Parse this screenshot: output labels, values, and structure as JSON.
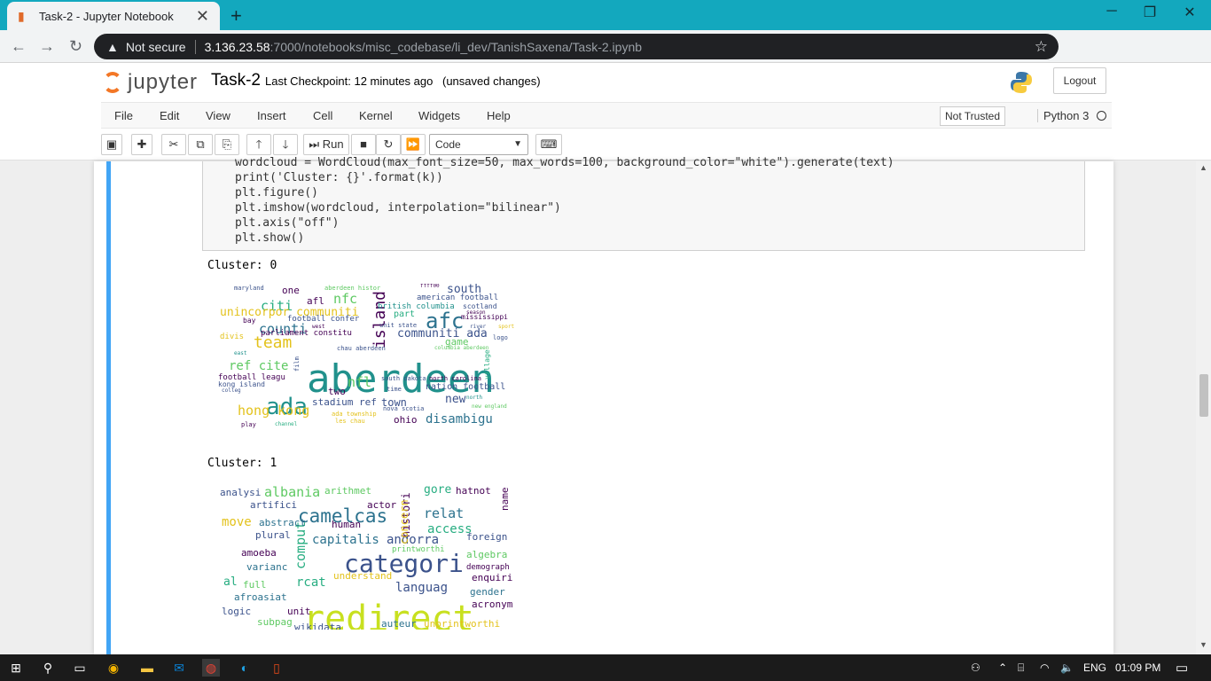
{
  "browser": {
    "tab_title": "Task-2 - Jupyter Notebook",
    "tab_close": "✕",
    "new_tab": "+",
    "security": "Not secure",
    "url_host": "3.136.23.58",
    "url_path": ":7000/notebooks/misc_codebase/li_dev/TanishSaxena/Task-2.ipynb"
  },
  "jupyter": {
    "logo_text": "jupyter",
    "notebook_name": "Task-2",
    "checkpoint_label": "Last Checkpoint:",
    "checkpoint_time": "12 minutes ago",
    "unsaved": "(unsaved changes)",
    "logout": "Logout",
    "menu": [
      "File",
      "Edit",
      "View",
      "Insert",
      "Cell",
      "Kernel",
      "Widgets",
      "Help"
    ],
    "trust": "Not Trusted",
    "kernel": "Python 3",
    "run_label": "Run",
    "cell_type": "Code"
  },
  "code_lines": [
    "wordcloud = WordCloud(max_font_size=50, max_words=100, background_color=\"white\").generate(text)",
    "print('Cluster: {}'.format(k))",
    "plt.figure()",
    "plt.imshow(wordcloud, interpolation=\"bilinear\")",
    "plt.axis(\"off\")",
    "plt.show()"
  ],
  "outputs": [
    {
      "label": "Cluster: 0",
      "words": [
        {
          "t": "aberdeen",
          "c": "#21918c",
          "s": 44
        },
        {
          "t": "ada",
          "c": "#21918c",
          "s": 26
        },
        {
          "t": "afc",
          "c": "#2c728e",
          "s": 24
        },
        {
          "t": "island",
          "c": "#440154",
          "s": 18
        },
        {
          "t": "team",
          "c": "#e3c21c",
          "s": 18
        },
        {
          "t": "counti",
          "c": "#2c728e",
          "s": 15
        },
        {
          "t": "citi",
          "c": "#27ad81",
          "s": 15
        },
        {
          "t": "nfc",
          "c": "#5ec962",
          "s": 15
        },
        {
          "t": "nfl",
          "c": "#5ec962",
          "s": 15
        },
        {
          "t": "hong kong",
          "c": "#e3c21c",
          "s": 15
        },
        {
          "t": "disambigu",
          "c": "#2c728e",
          "s": 14
        },
        {
          "t": "ref cite",
          "c": "#5ec962",
          "s": 14
        },
        {
          "t": "unincorpor communiti",
          "c": "#e3c21c",
          "s": 13
        },
        {
          "t": "communiti ada",
          "c": "#3b528b",
          "s": 13
        },
        {
          "t": "south",
          "c": "#3b528b",
          "s": 13
        },
        {
          "t": "new",
          "c": "#3b528b",
          "s": 13
        },
        {
          "t": "one",
          "c": "#440154",
          "s": 11
        },
        {
          "t": "afl",
          "c": "#440154",
          "s": 11
        },
        {
          "t": "two",
          "c": "#440154",
          "s": 11
        },
        {
          "t": "town",
          "c": "#3b528b",
          "s": 12
        },
        {
          "t": "game",
          "c": "#5ec962",
          "s": 11
        },
        {
          "t": "part",
          "c": "#27ad81",
          "s": 10
        },
        {
          "t": "ohio",
          "c": "#440154",
          "s": 11
        },
        {
          "t": "stadium ref",
          "c": "#3b528b",
          "s": 11
        },
        {
          "t": "nation football",
          "c": "#3b528b",
          "s": 10
        },
        {
          "t": "american football",
          "c": "#3b528b",
          "s": 9
        },
        {
          "t": "british columbia",
          "c": "#21918c",
          "s": 9
        },
        {
          "t": "scotland",
          "c": "#3b528b",
          "s": 8
        },
        {
          "t": "parliament constitu",
          "c": "#440154",
          "s": 9
        },
        {
          "t": "football confer",
          "c": "#3b528b",
          "s": 9
        },
        {
          "t": "football leagu",
          "c": "#440154",
          "s": 9
        },
        {
          "t": "kong island",
          "c": "#3b528b",
          "s": 8
        },
        {
          "t": "divis",
          "c": "#e3c21c",
          "s": 9
        },
        {
          "t": "mississippi",
          "c": "#440154",
          "s": 8
        },
        {
          "t": "south dakota",
          "c": "#3b528b",
          "s": 7
        },
        {
          "t": "north carolina",
          "c": "#440154",
          "s": 7
        },
        {
          "t": "village",
          "c": "#27ad81",
          "s": 8
        },
        {
          "t": "maryland",
          "c": "#3b528b",
          "s": 7
        },
        {
          "t": "aberdeen histor",
          "c": "#5ec962",
          "s": 7
        },
        {
          "t": "ffff00",
          "c": "#440154",
          "s": 6
        },
        {
          "t": "bay",
          "c": "#440154",
          "s": 8
        },
        {
          "t": "unit state",
          "c": "#3b528b",
          "s": 7
        },
        {
          "t": "chau aberdeen",
          "c": "#3b528b",
          "s": 7
        },
        {
          "t": "columbia aberdeen",
          "c": "#5ec962",
          "s": 6
        },
        {
          "t": "nova scotia",
          "c": "#3b528b",
          "s": 7
        },
        {
          "t": "ada township",
          "c": "#e3c21c",
          "s": 7
        },
        {
          "t": "les chau",
          "c": "#e3c21c",
          "s": 7
        },
        {
          "t": "play",
          "c": "#440154",
          "s": 7
        },
        {
          "t": "channel",
          "c": "#27ad81",
          "s": 6
        },
        {
          "t": "new england",
          "c": "#5ec962",
          "s": 6
        },
        {
          "t": "colleg",
          "c": "#3b528b",
          "s": 6
        },
        {
          "t": "film",
          "c": "#3b528b",
          "s": 7
        },
        {
          "t": "logo",
          "c": "#3b528b",
          "s": 7
        },
        {
          "t": "season",
          "c": "#440154",
          "s": 6
        },
        {
          "t": "west",
          "c": "#440154",
          "s": 6
        },
        {
          "t": "time",
          "c": "#3b528b",
          "s": 7
        },
        {
          "t": "north",
          "c": "#21918c",
          "s": 6
        },
        {
          "t": "river",
          "c": "#3b528b",
          "s": 6
        },
        {
          "t": "sport",
          "c": "#e3c21c",
          "s": 6
        },
        {
          "t": "east",
          "c": "#21918c",
          "s": 6
        }
      ]
    },
    {
      "label": "Cluster: 1",
      "words": [
        {
          "t": "redirect",
          "c": "#c8e020",
          "s": 40
        },
        {
          "t": "categori",
          "c": "#3b528b",
          "s": 28
        },
        {
          "t": "camelcas",
          "c": "#2c728e",
          "s": 21
        },
        {
          "t": "comput",
          "c": "#27ad81",
          "s": 15
        },
        {
          "t": "albania",
          "c": "#5ec962",
          "s": 15
        },
        {
          "t": "relat",
          "c": "#2c728e",
          "s": 15
        },
        {
          "t": "languag",
          "c": "#3b528b",
          "s": 14
        },
        {
          "t": "andorra",
          "c": "#3b528b",
          "s": 14
        },
        {
          "t": "move",
          "c": "#e3c21c",
          "s": 14
        },
        {
          "t": "capitalis",
          "c": "#2c728e",
          "s": 14
        },
        {
          "t": "access",
          "c": "#27ad81",
          "s": 14
        },
        {
          "t": "al",
          "c": "#27ad81",
          "s": 13
        },
        {
          "t": "rcat",
          "c": "#27ad81",
          "s": 14
        },
        {
          "t": "histori",
          "c": "#440154",
          "s": 12
        },
        {
          "t": "gore",
          "c": "#27ad81",
          "s": 13
        },
        {
          "t": "concern",
          "c": "#e3c21c",
          "s": 12
        },
        {
          "t": "arithmet",
          "c": "#5ec962",
          "s": 11
        },
        {
          "t": "analysi",
          "c": "#3b528b",
          "s": 11
        },
        {
          "t": "artifici",
          "c": "#3b528b",
          "s": 11
        },
        {
          "t": "actor",
          "c": "#440154",
          "s": 11
        },
        {
          "t": "hatnot",
          "c": "#440154",
          "s": 11
        },
        {
          "t": "name",
          "c": "#440154",
          "s": 11
        },
        {
          "t": "abstract",
          "c": "#2c728e",
          "s": 11
        },
        {
          "t": "human",
          "c": "#440154",
          "s": 11
        },
        {
          "t": "plural",
          "c": "#3b528b",
          "s": 11
        },
        {
          "t": "foreign",
          "c": "#3b528b",
          "s": 11
        },
        {
          "t": "amoeba",
          "c": "#440154",
          "s": 11
        },
        {
          "t": "printworthi",
          "c": "#5ec962",
          "s": 9
        },
        {
          "t": "algebra",
          "c": "#5ec962",
          "s": 11
        },
        {
          "t": "demograph",
          "c": "#440154",
          "s": 9
        },
        {
          "t": "varianc",
          "c": "#2c728e",
          "s": 11
        },
        {
          "t": "understand",
          "c": "#e3c21c",
          "s": 11
        },
        {
          "t": "enquiri",
          "c": "#440154",
          "s": 11
        },
        {
          "t": "full",
          "c": "#5ec962",
          "s": 11
        },
        {
          "t": "gender",
          "c": "#2c728e",
          "s": 11
        },
        {
          "t": "afroasiat",
          "c": "#2c728e",
          "s": 11
        },
        {
          "t": "acronym",
          "c": "#440154",
          "s": 11
        },
        {
          "t": "unit",
          "c": "#440154",
          "s": 11
        },
        {
          "t": "logic",
          "c": "#3b528b",
          "s": 11
        },
        {
          "t": "subpag",
          "c": "#5ec962",
          "s": 11
        },
        {
          "t": "wikidata",
          "c": "#3b528b",
          "s": 11
        },
        {
          "t": "auteur",
          "c": "#2c728e",
          "s": 11
        },
        {
          "t": "unprintworthi",
          "c": "#e3c21c",
          "s": 11
        }
      ]
    }
  ],
  "taskbar": {
    "lang": "ENG",
    "time": "01:09 PM"
  }
}
